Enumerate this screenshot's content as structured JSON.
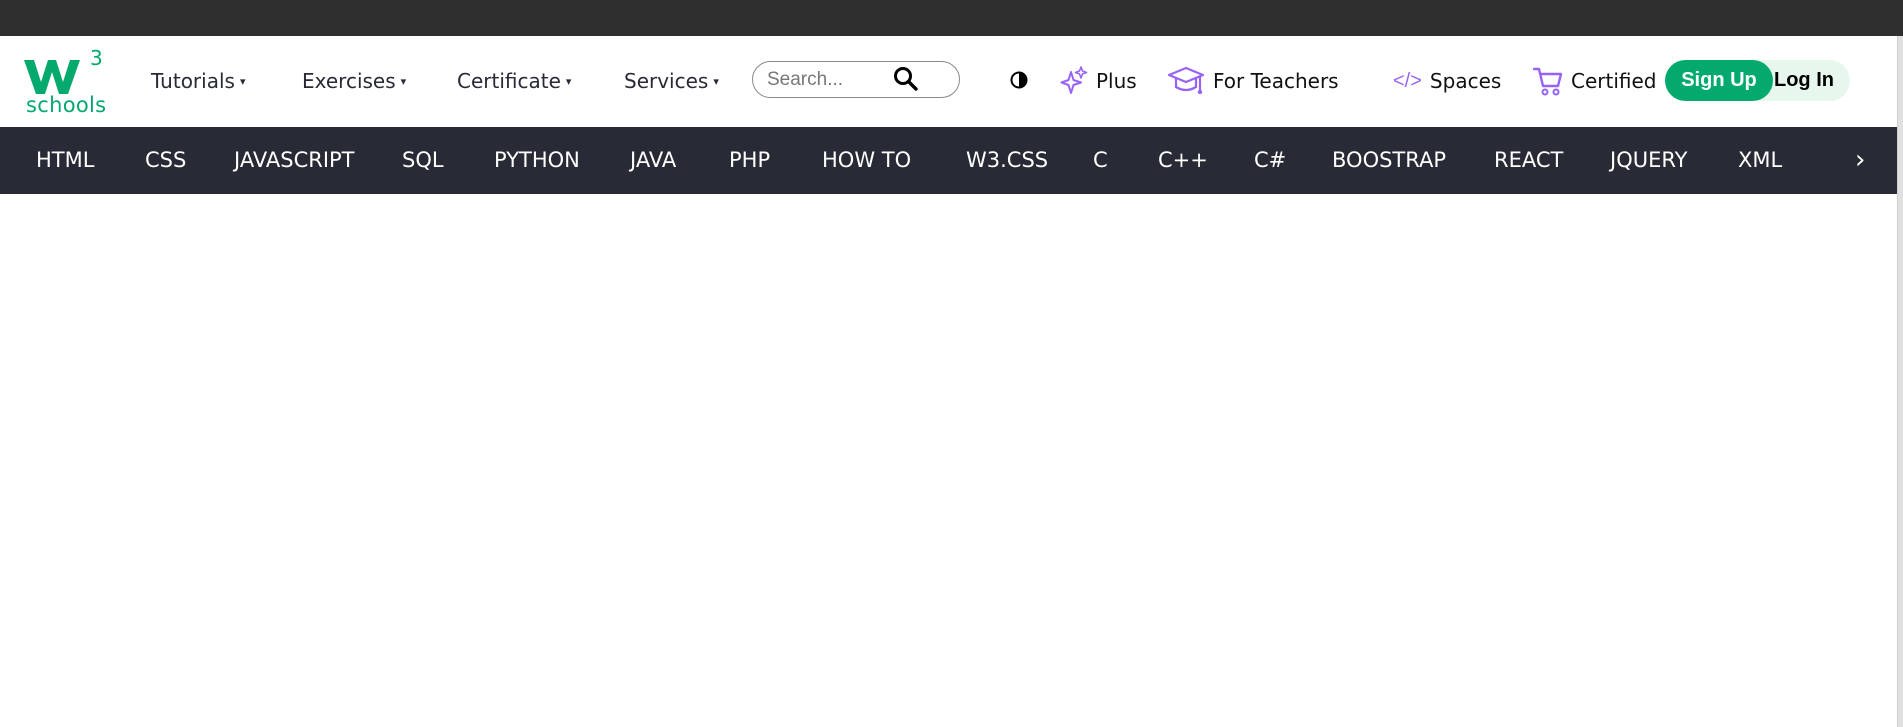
{
  "brand": {
    "logo_text": "schools",
    "logo_mark": "W3",
    "color": "#04AA6D"
  },
  "header": {
    "menus": [
      {
        "label": "Tutorials",
        "caret": "▾"
      },
      {
        "label": "Exercises",
        "caret": "▾"
      },
      {
        "label": "Certificate",
        "caret": "▾"
      },
      {
        "label": "Services",
        "caret": "▾"
      }
    ],
    "search": {
      "placeholder": "Search...",
      "icon": "search-icon"
    },
    "contrast_icon": "contrast-icon",
    "links": {
      "plus": "Plus",
      "teachers": "For Teachers",
      "spaces_code": "</>",
      "spaces": "Spaces",
      "certified": "Certified"
    },
    "signup": "Sign Up",
    "login": "Log In",
    "accent_purple": "#9763f6"
  },
  "subnav": {
    "items": [
      "HTML",
      "CSS",
      "JAVASCRIPT",
      "SQL",
      "PYTHON",
      "JAVA",
      "PHP",
      "HOW  TO",
      "W3.CSS",
      "C",
      "C++",
      "C#",
      "BOOSTRAP",
      "REACT",
      "JQUERY",
      "XML"
    ],
    "next_icon": "›",
    "background": "#282A35"
  }
}
